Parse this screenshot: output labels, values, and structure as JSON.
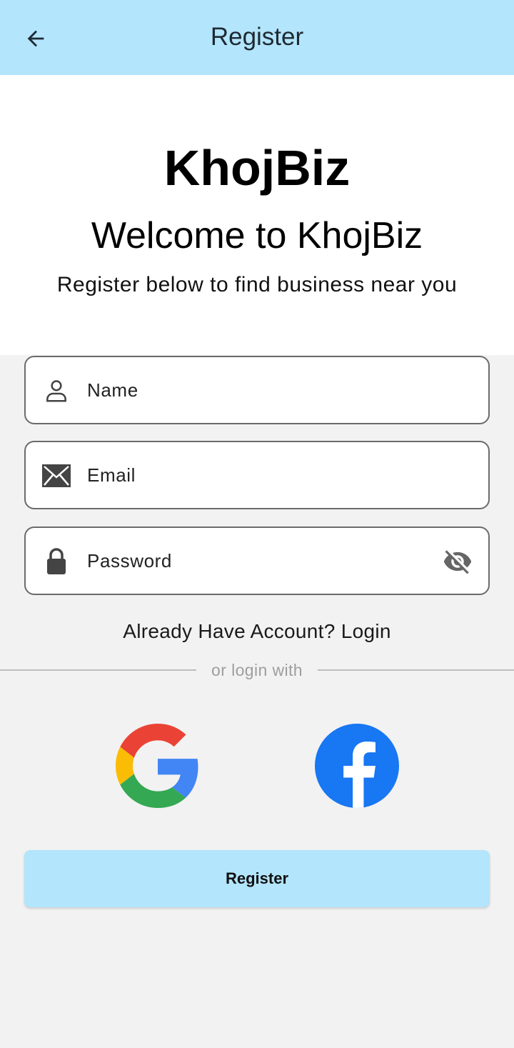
{
  "appbar": {
    "title": "Register",
    "back_icon": "arrow-left-icon",
    "background": "#b3e5fc"
  },
  "hero": {
    "brand": "KhojBiz",
    "welcome": "Welcome to KhojBiz",
    "tagline": "Register below to find business near you"
  },
  "form": {
    "name": {
      "placeholder": "Name",
      "value": "",
      "icon": "person-icon"
    },
    "email": {
      "placeholder": "Email",
      "value": "",
      "icon": "envelope-icon"
    },
    "password": {
      "placeholder": "Password",
      "value": "",
      "icon": "lock-icon",
      "toggle_icon": "eye-off-icon"
    }
  },
  "login_prompt": "Already Have Account? Login",
  "divider_text": "or login with",
  "social": [
    {
      "name": "google",
      "icon": "google-logo-icon"
    },
    {
      "name": "facebook",
      "icon": "facebook-logo-icon"
    }
  ],
  "register_button": {
    "label": "Register",
    "color": "#b3e5fc"
  },
  "colors": {
    "accent": "#b3e5fc",
    "facebook": "#1877f2",
    "google_red": "#ea4335",
    "google_yellow": "#fbbc05",
    "google_green": "#34a853",
    "google_blue": "#4285f4"
  }
}
